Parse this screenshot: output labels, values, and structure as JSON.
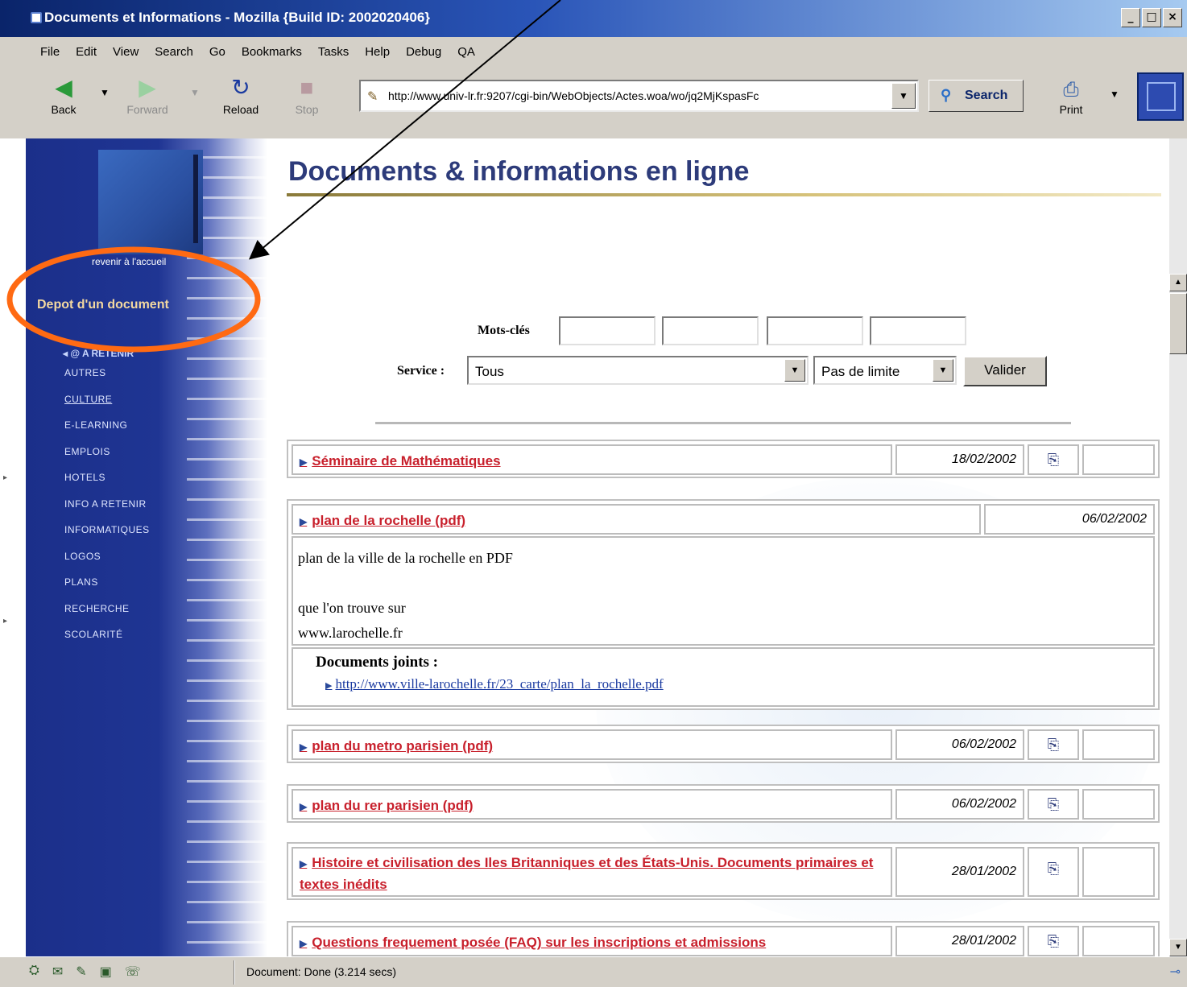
{
  "window": {
    "title": "Documents et Informations - Mozilla {Build ID: 2002020406}",
    "buttons": [
      "_",
      "□",
      "×"
    ]
  },
  "menu": [
    "File",
    "Edit",
    "View",
    "Search",
    "Go",
    "Bookmarks",
    "Tasks",
    "Help",
    "Debug",
    "QA"
  ],
  "toolbar": {
    "back": "Back",
    "forward": "Forward",
    "reload": "Reload",
    "stop": "Stop",
    "url": "http://www.univ-lr.fr:9207/cgi-bin/WebObjects/Actes.woa/wo/jq2MjKspasFc",
    "search": "Search",
    "print": "Print"
  },
  "sidebar": {
    "home_link": "revenir à l'accueil",
    "deposit": "Depot d'un document",
    "current": "A RETENIR",
    "items": [
      "AUTRES",
      "CULTURE",
      "E-LEARNING",
      "EMPLOIS",
      "HOTELS",
      "INFO A RETENIR",
      "INFORMATIQUES",
      "LOGOS",
      "PLANS",
      "RECHERCHE",
      "SCOLARITÉ"
    ]
  },
  "main": {
    "title": "Documents & informations en ligne"
  },
  "form": {
    "keywords_label": "Mots-clés",
    "service_label": "Service :",
    "service_value": "Tous",
    "limit_value": "Pas de limite",
    "submit": "Valider"
  },
  "documents": [
    {
      "title": "Séminaire de Mathématiques",
      "date": "18/02/2002"
    },
    {
      "title": "plan de la rochelle (pdf)",
      "date": "06/02/2002",
      "description": [
        "plan de la ville de la rochelle en PDF",
        "",
        "que l'on trouve sur",
        "www.larochelle.fr"
      ],
      "attachments_label": "Documents joints :",
      "attachment": "http://www.ville-larochelle.fr/23_carte/plan_la_rochelle.pdf"
    },
    {
      "title": "plan du metro parisien (pdf)",
      "date": "06/02/2002"
    },
    {
      "title": "plan du rer parisien (pdf)",
      "date": "06/02/2002"
    },
    {
      "title": "Histoire et civilisation des Iles Britanniques et des États-Unis. Documents primaires et textes inédits",
      "date": "28/01/2002"
    },
    {
      "title": "Questions frequement posée (FAQ) sur les inscriptions et admissions",
      "date": "28/01/2002"
    }
  ],
  "status": {
    "text": "Document: Done (3.214 secs)"
  },
  "colors": {
    "annotation_ellipse": "#ff6a13",
    "link_red": "#c8202c",
    "title_blue": "#2d3b7a",
    "sidebar_blue": "#1f3593"
  },
  "icons": {
    "attach": "document-attachment-icon",
    "arrow": "annotation-arrow"
  }
}
